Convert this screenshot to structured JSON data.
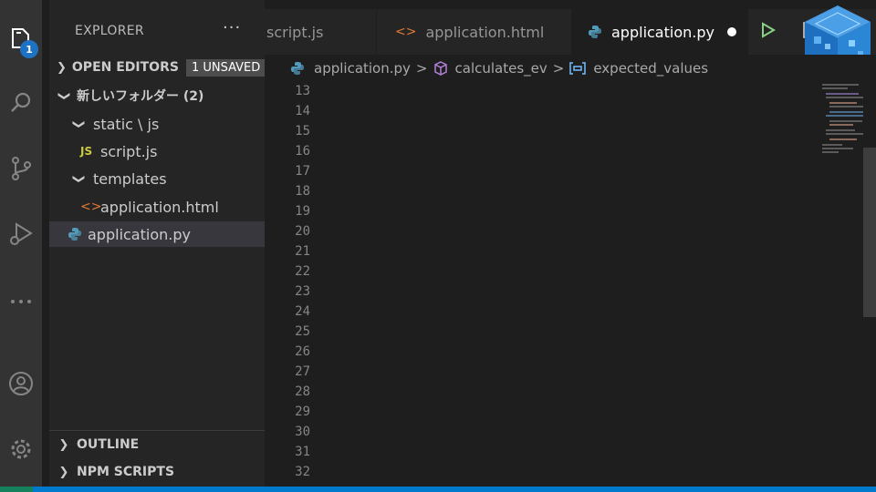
{
  "activity_bar": {
    "explorer_badge": "1"
  },
  "sidebar": {
    "title": "EXPLORER",
    "more_actions": "···",
    "open_editors": {
      "label": "OPEN EDITORS",
      "unsaved": "1 UNSAVED"
    },
    "folder": {
      "label": "新しいフォルダー (2)"
    },
    "tree": [
      {
        "label": "static \\ js",
        "type": "folder"
      },
      {
        "label": "script.js",
        "type": "js",
        "icon_text": "JS"
      },
      {
        "label": "templates",
        "type": "folder"
      },
      {
        "label": "application.html",
        "type": "html",
        "icon_text": "<>"
      },
      {
        "label": "application.py",
        "type": "py"
      }
    ],
    "outline": "OUTLINE",
    "npm_scripts": "NPM SCRIPTS"
  },
  "tabs": [
    {
      "label": "script.js"
    },
    {
      "label": "application.html",
      "icon_text": "<>"
    },
    {
      "label": "application.py",
      "active": true
    }
  ],
  "breadcrumb": {
    "file": "application.py",
    "function": "calculates_ev",
    "variable": "expected_values",
    "separator": ">"
  },
  "editor": {
    "line_numbers": [
      "13",
      "14",
      "15",
      "16",
      "17",
      "18",
      "19",
      "20",
      "21",
      "22",
      "23",
      "24",
      "25",
      "26",
      "27",
      "28",
      "29",
      "30",
      "31",
      "32"
    ]
  },
  "colors": {
    "accent": "#007acc",
    "keyword": "#569cd6",
    "control": "#c586c0",
    "function": "#dcdcaa",
    "string": "#ce9178",
    "selection": "#264f78"
  }
}
